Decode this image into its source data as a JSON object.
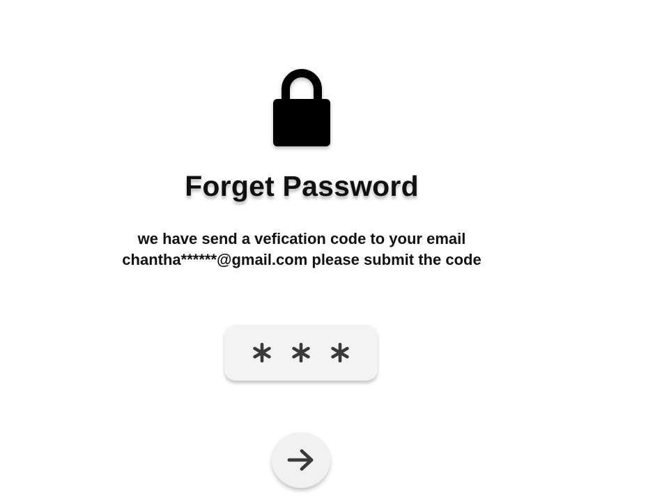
{
  "page": {
    "title": "Forget Password",
    "message_line1": "we have send a vefication code to your email",
    "message_line2": "chantha******@gmail.com please submit the code"
  },
  "code_input": {
    "digits": [
      "*",
      "*",
      "*"
    ]
  },
  "icons": {
    "header": "lock-icon",
    "submit": "arrow-right-icon",
    "digit_mask": "asterisk-icon"
  },
  "colors": {
    "text": "#111111",
    "input_background": "#f3f3f3",
    "button_background": "#f1f1f1",
    "icon": "#3a3a3a"
  }
}
